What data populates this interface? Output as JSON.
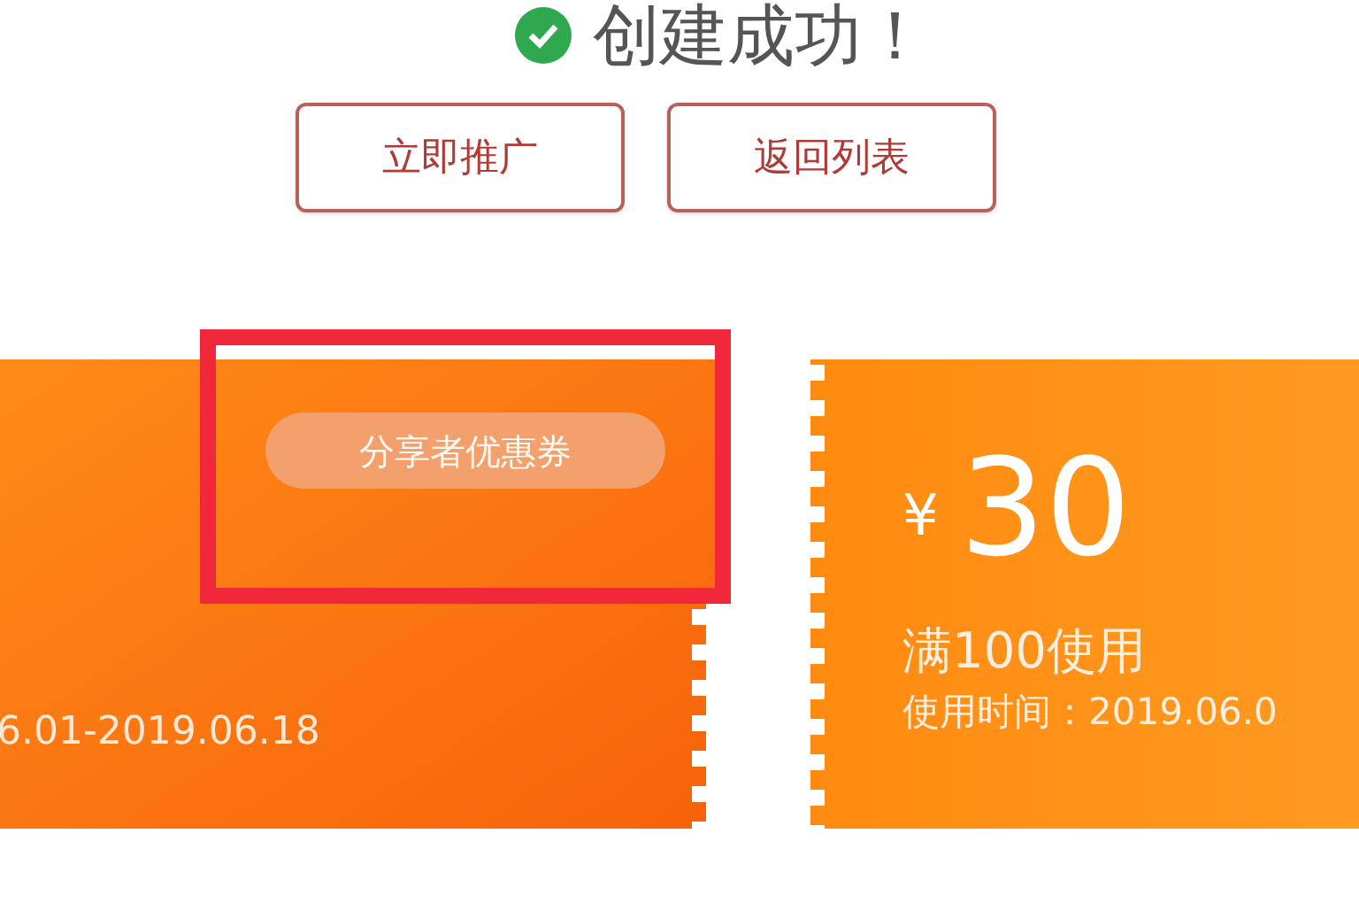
{
  "title": "创建成功！",
  "buttons": [
    "立即推广",
    "返回列表"
  ],
  "coupons": [
    {
      "tag": "分享者优惠券",
      "validity": "6.01-2019.06.18"
    },
    {
      "currency": "¥",
      "amount": "30",
      "condition": "满100使用",
      "validity": "使用时间：2019.06.0"
    }
  ]
}
